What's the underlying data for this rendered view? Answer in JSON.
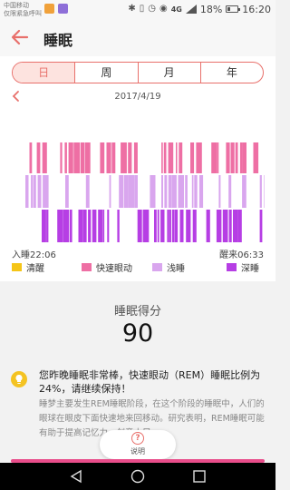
{
  "status_bar": {
    "carrier_line1": "中国移动",
    "carrier_line2": "仅限紧急呼叫",
    "network": "4G",
    "battery": "18%",
    "time": "16:20",
    "icons": [
      "bluetooth-icon",
      "vibrate-icon",
      "alarm-icon",
      "eye-icon",
      "signal-icon",
      "battery-icon"
    ]
  },
  "header": {
    "title": "睡眠",
    "back_icon": "arrow-left-icon"
  },
  "tabs": [
    {
      "label": "日",
      "active": true
    },
    {
      "label": "周",
      "active": false
    },
    {
      "label": "月",
      "active": false
    },
    {
      "label": "年",
      "active": false
    }
  ],
  "date_nav": {
    "date": "2017/4/19",
    "prev_icon": "chevron-left-icon"
  },
  "chart_data": {
    "type": "bar",
    "sleep_start": "入睡22:06",
    "wake_time": "醒来06:33",
    "stages": [
      "清醒",
      "快速眼动",
      "浅睡",
      "深睡"
    ],
    "colors": {
      "清醒": "#f5c518",
      "快速眼动": "#ee6fa4",
      "浅睡": "#d9a6ee",
      "深睡": "#b63ee4"
    }
  },
  "legend": [
    {
      "label": "清醒",
      "color": "#f5c518"
    },
    {
      "label": "快速眼动",
      "color": "#ee6fa4"
    },
    {
      "label": "浅睡",
      "color": "#d9a6ee"
    },
    {
      "label": "深睡",
      "color": "#b63ee4"
    }
  ],
  "score": {
    "title": "睡眠得分",
    "value": "90"
  },
  "tip": {
    "icon": "lightbulb-icon",
    "main": "您昨晚睡眠非常棒，快速眼动（REM）睡眠比例为24%，请继续保持！",
    "detail": "睡梦主要发生REM睡眠阶段，在这个阶段的睡眠中，人们的眼球在眼皮下面快速地来回移动。研究表明，REM睡眠可能有助于提高记忆力、创意十足。"
  },
  "info_button": {
    "label": "说明",
    "icon": "question-circle-icon"
  },
  "nav": [
    "back-triangle-icon",
    "home-circle-icon",
    "recents-square-icon"
  ]
}
